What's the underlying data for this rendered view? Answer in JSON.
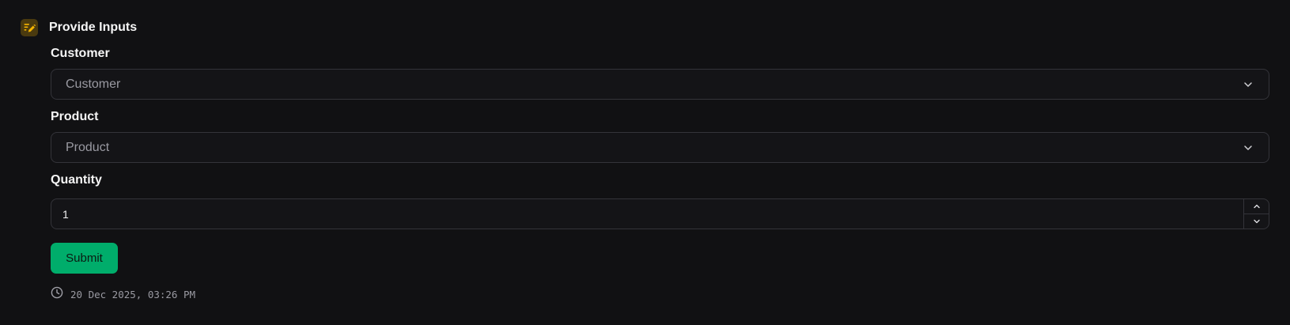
{
  "header": {
    "title": "Provide Inputs",
    "icon": "edit-form-icon",
    "icon_color": "#f5b400"
  },
  "form": {
    "customer": {
      "label": "Customer",
      "selected": "Customer"
    },
    "product": {
      "label": "Product",
      "selected": "Product"
    },
    "quantity": {
      "label": "Quantity",
      "value": "1"
    },
    "submit_label": "Submit"
  },
  "timestamp": {
    "icon": "clock-icon",
    "text": "20 Dec 2025, 03:26 PM"
  },
  "colors": {
    "background": "#111113",
    "accent": "#00ad6b",
    "border": "#34343a"
  }
}
